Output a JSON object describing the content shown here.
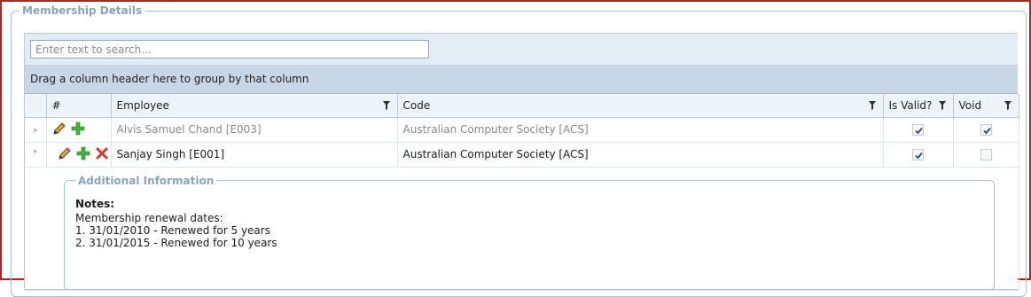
{
  "fieldset_title": "Membership Details",
  "search": {
    "placeholder": "Enter text to search...",
    "value": ""
  },
  "group_panel_text": "Drag a column header here to group by that column",
  "columns": {
    "num": "#",
    "employee": "Employee",
    "code": "Code",
    "is_valid": "Is Valid?",
    "void": "Void"
  },
  "rows": [
    {
      "expander": "›",
      "employee": "Alvis Samuel Chand [E003]",
      "code": "Australian Computer Society [ACS]",
      "is_valid": true,
      "void": true,
      "commands": [
        "edit-icon",
        "add-icon"
      ]
    },
    {
      "expander": "˅",
      "employee": "Sanjay Singh [E001]",
      "code": "Australian Computer Society [ACS]",
      "is_valid": true,
      "void": false,
      "commands": [
        "edit-icon",
        "add-icon",
        "delete-icon"
      ]
    }
  ],
  "detail": {
    "title": "Additional Information",
    "notes_label": "Notes:",
    "lines": [
      "Membership renewal dates:",
      "1. 31/01/2010 - Renewed for 5 years",
      "2. 31/01/2015 - Renewed for 10 years"
    ]
  }
}
